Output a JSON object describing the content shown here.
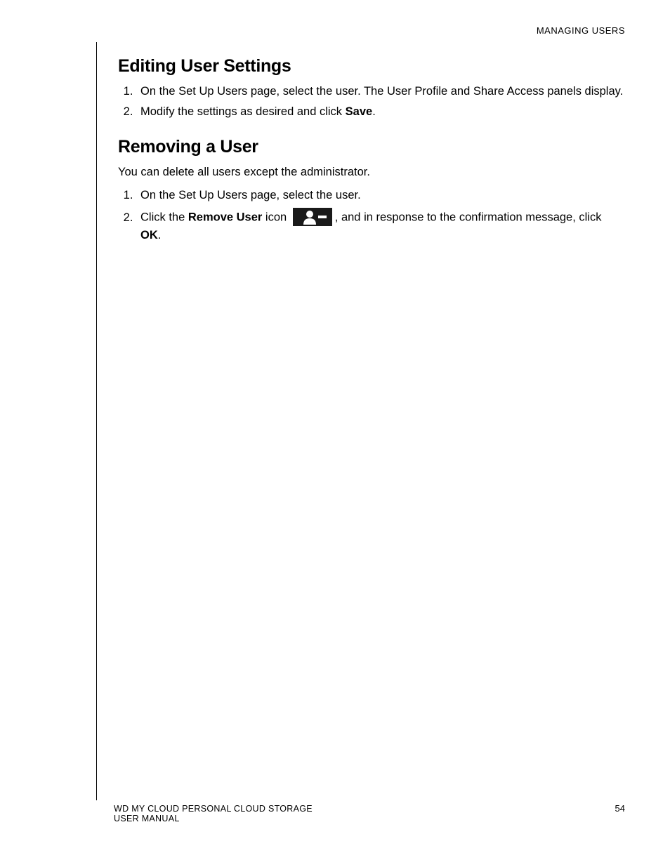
{
  "header": {
    "section_label": "MANAGING USERS"
  },
  "sections": {
    "edit": {
      "heading": "Editing User Settings",
      "step1": "On the Set Up Users page, select the user. The User Profile and Share Access panels display.",
      "step2_a": "Modify the settings as desired and click ",
      "step2_bold": "Save",
      "step2_b": "."
    },
    "remove": {
      "heading": "Removing a User",
      "intro": "You can delete all users except the administrator.",
      "step1": "On the Set Up Users page, select the user.",
      "step2_a": "Click the ",
      "step2_bold1": "Remove User",
      "step2_b": " icon ",
      "step2_c": ", and in response to the confirmation message, click ",
      "step2_bold2": "OK",
      "step2_d": "."
    }
  },
  "footer": {
    "line1": "WD MY CLOUD PERSONAL CLOUD STORAGE",
    "line2": "USER MANUAL",
    "page_number": "54"
  }
}
